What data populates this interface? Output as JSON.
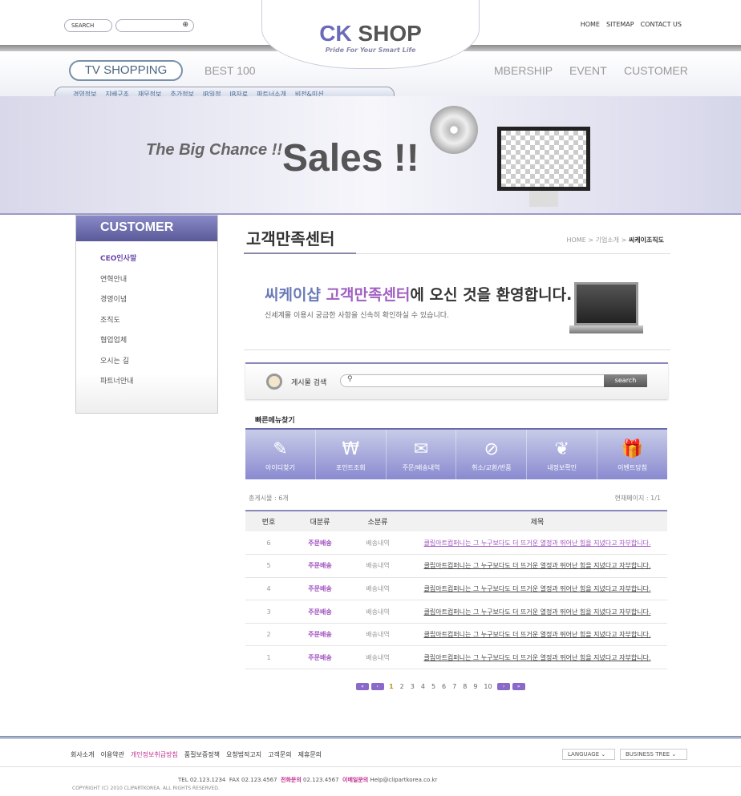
{
  "header": {
    "search_label": "SEARCH",
    "search_placeholder": "",
    "logo_ck": "CK",
    "logo_shop": " SHOP",
    "tagline": "Pride For Your Smart Life",
    "top_links": [
      "HOME",
      "SITEMAP",
      "CONTACT US"
    ]
  },
  "nav": {
    "tv_shopping": "TV SHOPPING",
    "best": "BEST 100",
    "right": [
      "MBERSHIP",
      "EVENT",
      "CUSTOMER"
    ],
    "sub": [
      "경영정보",
      "지배구조",
      "재무정보",
      "추가정보",
      "IR일정",
      "IR자료",
      "파트너소개",
      "비전&미션"
    ]
  },
  "hero": {
    "tagline": "The Big Chance !!",
    "title": "Sales !!"
  },
  "sidebar": {
    "title": "CUSTOMER",
    "items": [
      "CEO인사말",
      "연혁안내",
      "경영이념",
      "조직도",
      "협업업체",
      "오시는 길",
      "파트너안내"
    ]
  },
  "main": {
    "title": "고객만족센터",
    "breadcrumb": [
      "HOME",
      "기업소개",
      "씨케이조직도"
    ],
    "welcome": {
      "a": "씨케이샵",
      "b": " 고객만족센터",
      "c": "에 오신 것을 환영합니다.",
      "sub": "신세계몰 이용시 궁금한 사항을 신속히 확인하실 수 있습니다."
    },
    "search": {
      "label": "게시물 검색",
      "button": "search"
    },
    "quick_title": "빠른메뉴찾기",
    "quick": [
      {
        "label": "아이디찾기",
        "icon": "document-pencil-icon"
      },
      {
        "label": "포인트조회",
        "icon": "won-register-icon"
      },
      {
        "label": "주문/배송내역",
        "icon": "mail-icon"
      },
      {
        "label": "취소/교환/반품",
        "icon": "cancel-card-icon"
      },
      {
        "label": "내정보확인",
        "icon": "plant-hands-icon"
      },
      {
        "label": "이벤트당첨",
        "icon": "gift-icon"
      }
    ],
    "total": "총게시물 : 6개",
    "current_page": "현재페이지 : 1/1",
    "columns": [
      "번호",
      "대분류",
      "소분류",
      "제목"
    ],
    "rows": [
      [
        "6",
        "주문배송",
        "배송내역",
        "클립아트컴퍼니는 그 누구보다도 더 뜨거운 열정과 뛰어난 힘을 지녔다고 자부합니다."
      ],
      [
        "5",
        "주문배송",
        "배송내역",
        "클립아트컴퍼니는 그 누구보다도 더 뜨거운 열정과 뛰어난 힘을 지녔다고 자부합니다."
      ],
      [
        "4",
        "주문배송",
        "배송내역",
        "클립아트컴퍼니는 그 누구보다도 더 뜨거운 열정과 뛰어난 힘을 지녔다고 자부합니다."
      ],
      [
        "3",
        "주문배송",
        "배송내역",
        "클립아트컴퍼니는 그 누구보다도 더 뜨거운 열정과 뛰어난 힘을 지녔다고 자부합니다."
      ],
      [
        "2",
        "주문배송",
        "배송내역",
        "클립아트컴퍼니는 그 누구보다도 더 뜨거운 열정과 뛰어난 힘을 지녔다고 자부합니다."
      ],
      [
        "1",
        "주문배송",
        "배송내역",
        "클립아트컴퍼니는 그 누구보다도 더 뜨거운 열정과 뛰어난 힘을 지녔다고 자부합니다."
      ]
    ],
    "pages": [
      "1",
      "2",
      "3",
      "4",
      "5",
      "6",
      "7",
      "8",
      "9",
      "10"
    ]
  },
  "footer": {
    "links": [
      "회사소개",
      "이용약관",
      "개인정보취급방침",
      "품질보증정책",
      "요청법적고지",
      "고객문의",
      "제휴문의"
    ],
    "language": "LANGUAGE",
    "business": "BUSINESS TREE",
    "tel": "TEL 02.123.1234",
    "fax": "FAX 02.123.4567",
    "phone_label": "전화문의",
    "phone": "02.123.4567",
    "email_label": "이메일문의",
    "email": "Help@clipartkorea.co.kr",
    "copyright": "COPYRIGHT (C) 2010 CLIPARTKOREA. ALL RIGHTS RESERVED."
  },
  "colors": {
    "accent": "#8a8ad0",
    "highlight": "#a050c0"
  }
}
